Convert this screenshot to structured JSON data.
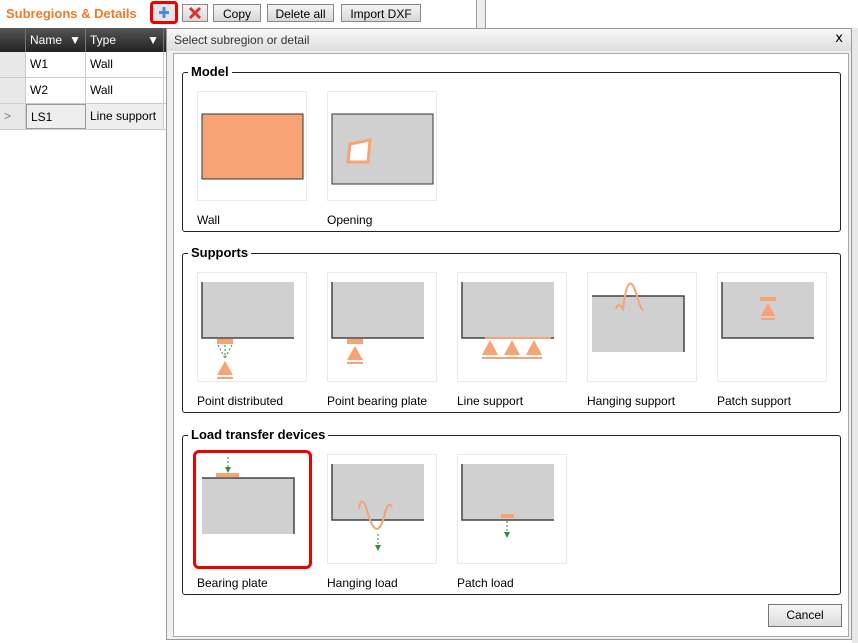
{
  "panel": {
    "title": "Subregions & Details",
    "add_icon": "plus-icon",
    "delete_icon": "x-icon",
    "copy": "Copy",
    "delete_all": "Delete all",
    "import_dxf": "Import DXF"
  },
  "grid": {
    "columns": [
      "Name",
      "Type"
    ],
    "rows": [
      {
        "name": "W1",
        "type": "Wall"
      },
      {
        "name": "W2",
        "type": "Wall"
      },
      {
        "name": "LS1",
        "type": "Line support",
        "current": true
      }
    ],
    "current_marker": ">"
  },
  "dialog": {
    "title": "Select subregion or detail",
    "close": "x",
    "cancel": "Cancel",
    "groups": [
      {
        "label": "Model",
        "items": [
          "Wall",
          "Opening"
        ]
      },
      {
        "label": "Supports",
        "items": [
          "Point distributed",
          "Point bearing plate",
          "Line support",
          "Hanging support",
          "Patch support"
        ]
      },
      {
        "label": "Load transfer devices",
        "items": [
          "Bearing plate",
          "Hanging load",
          "Patch load"
        ],
        "selected": "Bearing plate"
      }
    ]
  },
  "colors": {
    "accent": "#f07a28",
    "icon_orange": "#f7a374",
    "icon_gray": "#d0d0d0",
    "arrow_green": "#3a8a3a",
    "highlight": "#e00000"
  }
}
